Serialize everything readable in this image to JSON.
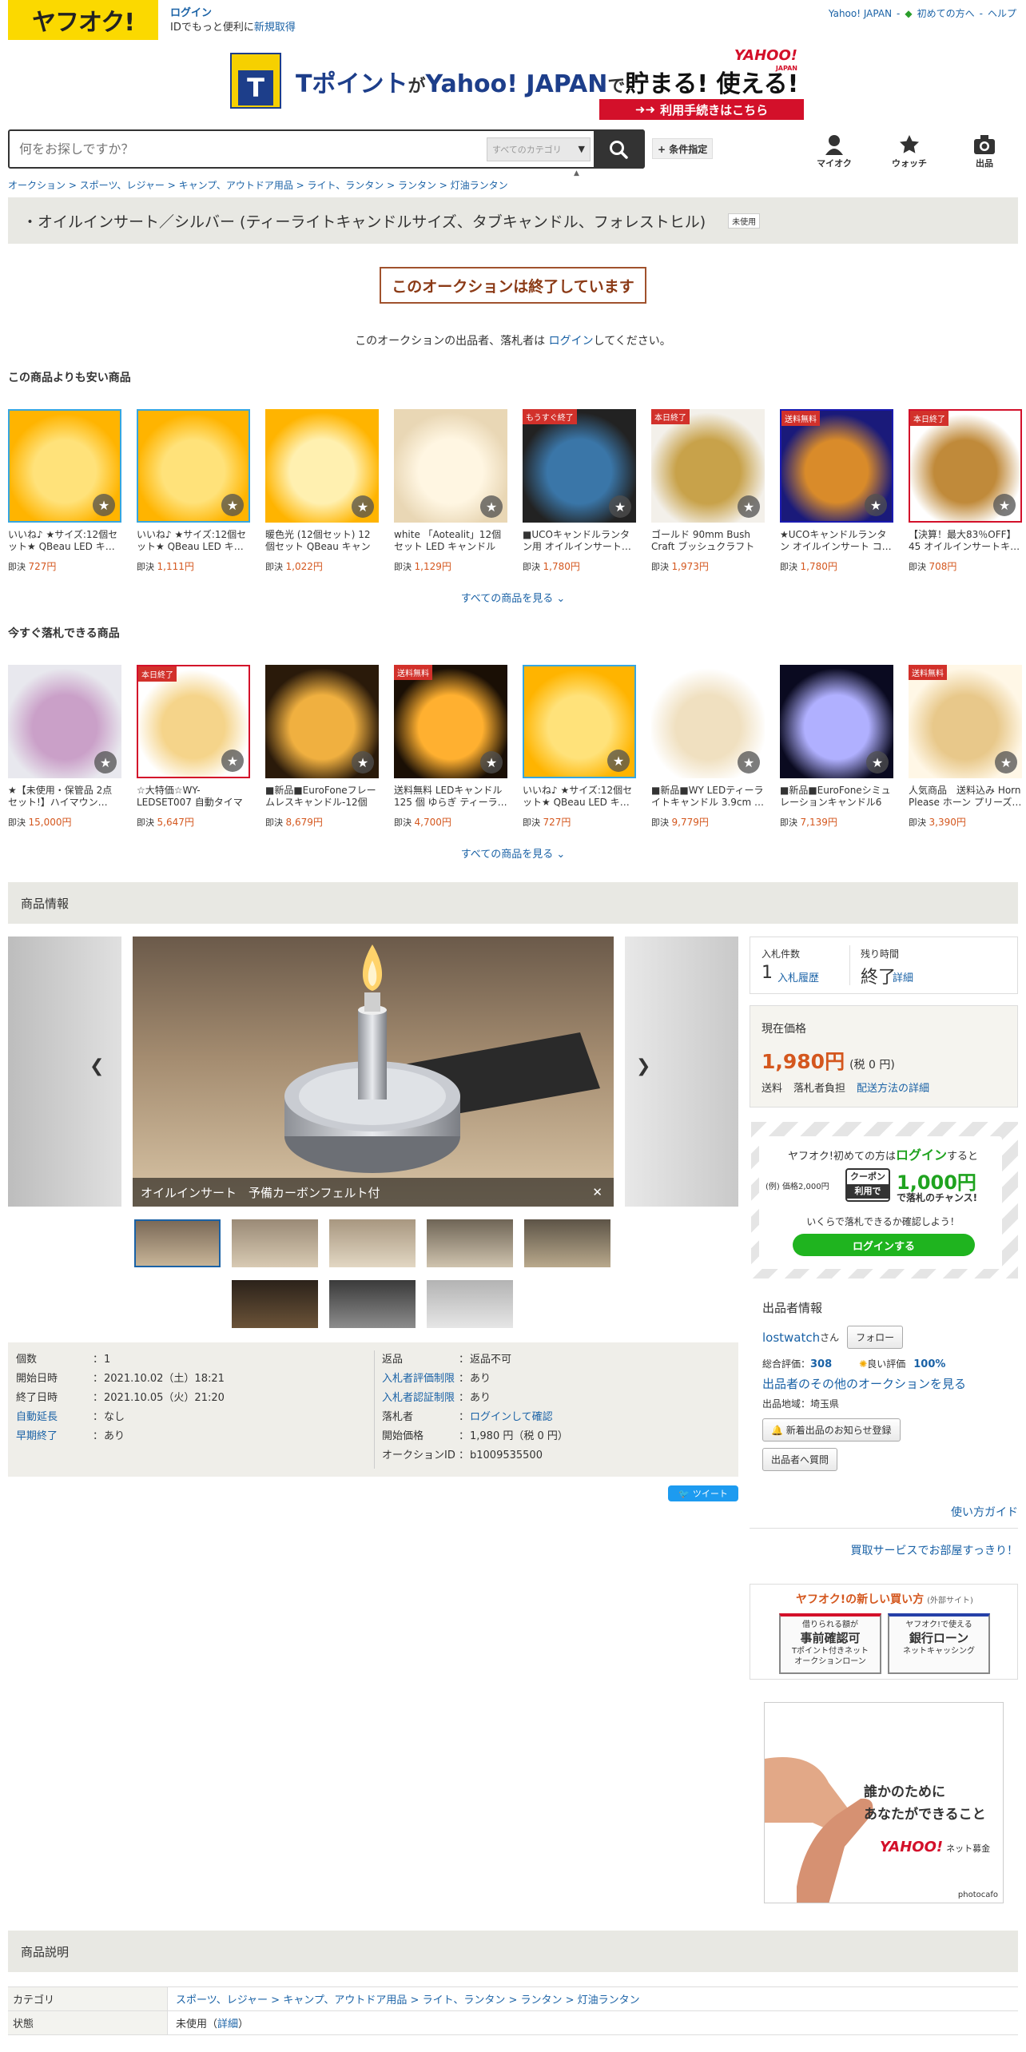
{
  "header": {
    "logo": "ヤフオク!",
    "login": "ログイン",
    "login_sub": "IDでもっと便利に",
    "register": "新規取得",
    "links": [
      "Yahoo! JAPAN",
      "初めての方へ",
      "ヘルプ"
    ]
  },
  "banner": {
    "text1": "Tポイント",
    "text2": "が",
    "text3": "Yahoo! JAPAN",
    "text4": "で",
    "text5": "貯まる! 使える!",
    "brand": "YAHOO!",
    "brand_sub": "JAPAN",
    "cta": "利用手続きはこちら"
  },
  "search": {
    "placeholder": "何をお探しですか？",
    "category": "すべてのカテゴリ",
    "condition": "+ 条件指定"
  },
  "nav": {
    "myauction": "マイオク",
    "watch": "ウォッチ",
    "sell": "出品"
  },
  "breadcrumb": "オークション > スポーツ、レジャー > キャンプ、アウトドア用品 > ライト、ランタン > ランタン > 灯油ランタン",
  "title": "・オイルインサート／シルバー (ティーライトキャンドルサイズ、タブキャンドル、フォレストヒル)",
  "condition_badge": "未使用",
  "ended": "このオークションは終了しています",
  "endmsg": {
    "pre": "このオークションの出品者、落札者は ",
    "link": "ログイン",
    "post": "してください。"
  },
  "cheaper": {
    "heading": "この商品よりも安い商品",
    "see_all": "すべての商品を見る",
    "items": [
      {
        "name": "いいね♪ ★サイズ:12個セット★ QBeau LED キ…",
        "label": "即決",
        "price": "727円",
        "tag": ""
      },
      {
        "name": "いいね♪ ★サイズ:12個セット★ QBeau LED キ…",
        "label": "即決",
        "price": "1,111円",
        "tag": ""
      },
      {
        "name": "暖色光 (12個セット) 12個セット QBeau キャンド…",
        "label": "即決",
        "price": "1,022円",
        "tag": ""
      },
      {
        "name": "white 「Aotealit」12個セット LED キャンドルラ…",
        "label": "即決",
        "price": "1,129円",
        "tag": ""
      },
      {
        "name": "■UCOキャンドルランタン用 オイルインサート…",
        "label": "即決",
        "price": "1,780円",
        "tag": "もうすぐ終了"
      },
      {
        "name": "ゴールド 90mm Bush Craft ブッシュクラフト オ…",
        "label": "即決",
        "price": "1,973円",
        "tag": "本日終了"
      },
      {
        "name": "★UCOキャンドルランタン オイルインサート コ…",
        "label": "即決",
        "price": "1,780円",
        "tag": "送料無料"
      },
      {
        "name": "【決算！最大83％OFF】45 オイルインサートキ…",
        "label": "即決",
        "price": "708円",
        "tag": "本日終了"
      }
    ]
  },
  "soon": {
    "heading": "今すぐ落札できる商品",
    "see_all": "すべての商品を見る",
    "items": [
      {
        "name": "★【未使用・保管品 2点セット!】ハイマウン…",
        "label": "即決",
        "price": "15,000円",
        "tag": ""
      },
      {
        "name": "☆大特価☆WY-LEDSET007 自動タイマー (ウォ…",
        "label": "即決",
        "price": "5,647円",
        "tag": "本日終了"
      },
      {
        "name": "■新品■EuroFoneフレームレスキャンドル-12個の…",
        "label": "即決",
        "price": "8,679円",
        "tag": ""
      },
      {
        "name": "送料無料 LEDキャンドル 125 個 ゆらぎ ティーラ…",
        "label": "即決",
        "price": "4,700円",
        "tag": "送料無料"
      },
      {
        "name": "いいね♪ ★サイズ:12個セット★ QBeau LED キ…",
        "label": "即決",
        "price": "727円",
        "tag": ""
      },
      {
        "name": "■新品■WY LEDティーライトキャンドル 3.9cm …",
        "label": "即決",
        "price": "9,779円",
        "tag": ""
      },
      {
        "name": "■新品■EuroFoneシミュレーションキャンドル6つ…",
        "label": "即決",
        "price": "7,139円",
        "tag": ""
      },
      {
        "name": "人気商品　送料込み Horn Please ホーン プリーズ…",
        "label": "即決",
        "price": "3,390円",
        "tag": "送料無料"
      }
    ]
  },
  "product_info": "商品情報",
  "gallery": {
    "caption": "オイルインサート　予備カーボンフェルト付"
  },
  "bids": {
    "count_label": "入札件数",
    "count": "1",
    "history": "入札履歴",
    "remain_label": "残り時間",
    "remain": "終了",
    "detail": "詳細"
  },
  "price": {
    "label": "現在価格",
    "value": "1,980円",
    "tax": "(税 0 円)",
    "ship_label": "送料",
    "ship": "落札者負担",
    "ship_link": "配送方法の詳細"
  },
  "promo": {
    "line1a": "ヤフオク!初めての方は",
    "line1b": "ログイン",
    "line1c": "すると",
    "ex": "(例) 価格2,000円",
    "coupon": "クーポン",
    "use": "利用で",
    "amount": "1,000円",
    "win": "で落札のチャンス!",
    "check": "いくらで落札できるか確認しよう！",
    "btn": "ログインする"
  },
  "seller": {
    "heading": "出品者情報",
    "name": "lostwatch",
    "san": "さん",
    "follow": "フォロー",
    "total_label": "総合評価：",
    "total": "308",
    "good_label": "良い評価",
    "good": "100%",
    "other": "出品者のその他のオークションを見る",
    "region": "出品地域：埼玉県",
    "notify": "新着出品のお知らせ登録",
    "ask": "出品者へ質問",
    "guide": "使い方ガイド",
    "service": "買取サービスでお部屋すっきり！"
  },
  "details": {
    "left": [
      [
        "個数",
        "1"
      ],
      [
        "開始日時",
        "2021.10.02（土）18:21"
      ],
      [
        "終了日時",
        "2021.10.05（火）21:20"
      ],
      [
        "自動延長",
        "なし"
      ],
      [
        "早期終了",
        "あり"
      ]
    ],
    "right": [
      [
        "返品",
        "返品不可"
      ],
      [
        "入札者評価制限",
        "あり"
      ],
      [
        "入札者認証制限",
        "あり"
      ],
      [
        "落札者",
        "ログインして確認"
      ],
      [
        "開始価格",
        "1,980 円（税 0 円）"
      ],
      [
        "オークションID",
        "b1009535500"
      ]
    ]
  },
  "tweet": "ツイート",
  "newway": {
    "title": "ヤフオク!の新しい買い方",
    "ext": "(外部サイト)",
    "b1a": "借りられる額が",
    "b1b": "事前確認可",
    "b1c": "Tポイント付きネット",
    "b1d": "オークションローン",
    "b2a": "ヤフオク!で使える",
    "b2b": "銀行ローン",
    "b2c": "ネットキャッシング"
  },
  "charity": {
    "l1": "誰かのために",
    "l2": "あなたができること",
    "brand": "YAHOO!",
    "sub": "ネット募金",
    "credit": "photocafo"
  },
  "description": {
    "heading": "商品説明",
    "rows": [
      [
        "カテゴリ",
        "スポーツ、レジャー > キャンプ、アウトドア用品 > ライト、ランタン > ランタン > 灯油ランタン"
      ],
      [
        "状態",
        "未使用"
      ]
    ],
    "detail": "詳細"
  }
}
